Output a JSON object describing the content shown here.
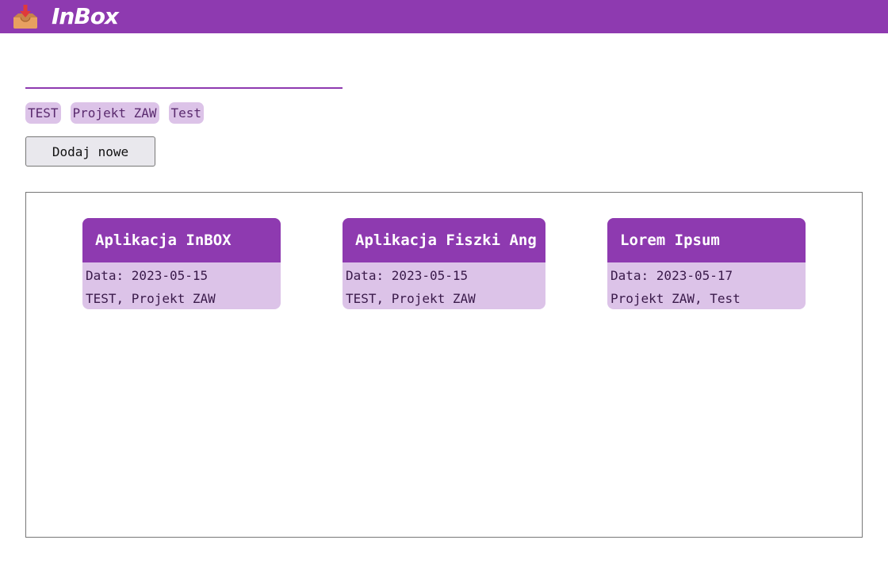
{
  "header": {
    "app_title": "InBox",
    "logo_icon": "inbox-tray-icon",
    "background_color": "#8e3ab0"
  },
  "search": {
    "value": "",
    "placeholder": ""
  },
  "tags": [
    {
      "label": "TEST"
    },
    {
      "label": "Projekt ZAW"
    },
    {
      "label": "Test"
    }
  ],
  "actions": {
    "add_new_label": "Dodaj nowe"
  },
  "cards": [
    {
      "title": "Aplikacja InBOX",
      "date": "Data: 2023-05-15",
      "tags": "TEST, Projekt ZAW"
    },
    {
      "title": "Aplikacja Fiszki Ang",
      "date": "Data: 2023-05-15",
      "tags": "TEST, Projekt ZAW"
    },
    {
      "title": "Lorem Ipsum",
      "date": "Data: 2023-05-17",
      "tags": "Projekt ZAW, Test"
    }
  ],
  "colors": {
    "accent": "#8e3ab0",
    "tag_background": "#dcc3e8"
  }
}
